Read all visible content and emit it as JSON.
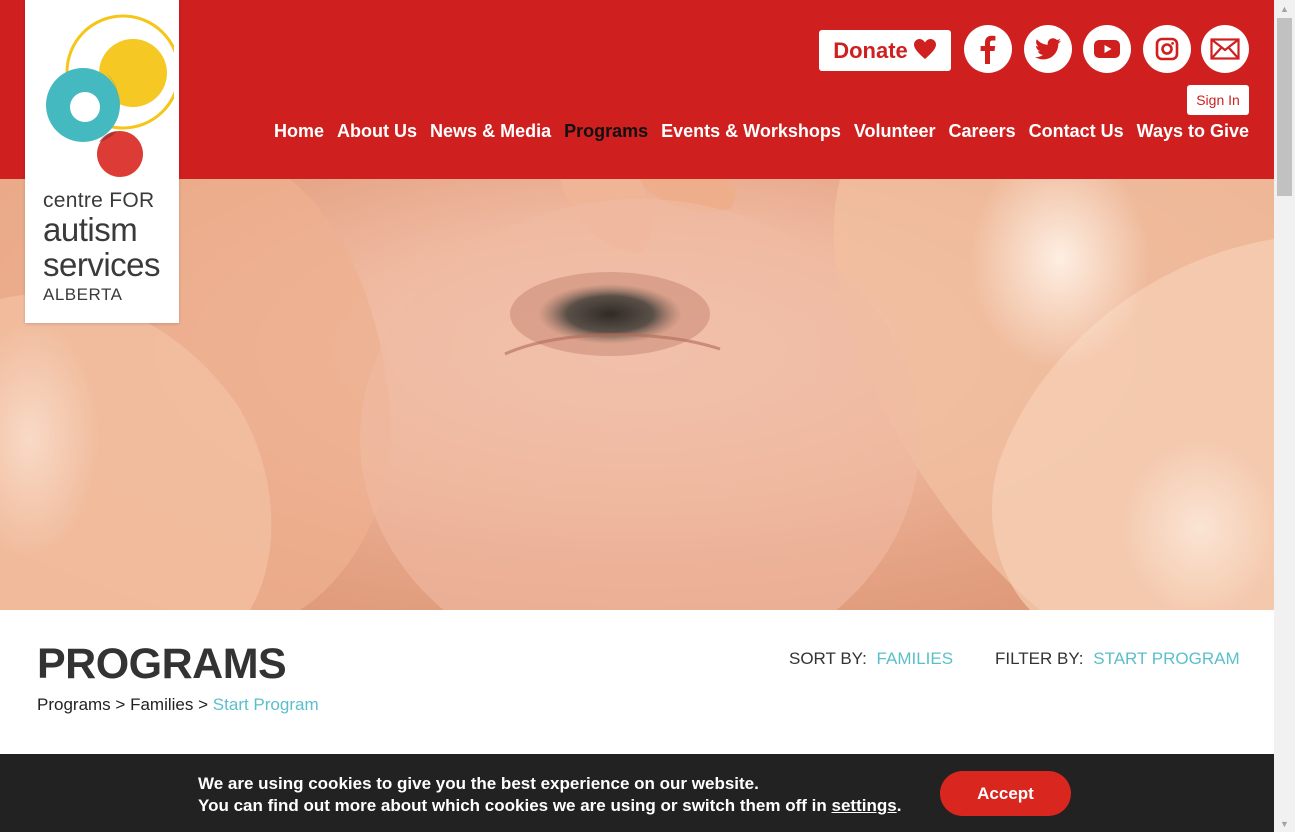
{
  "logo": {
    "line1": "centre FOR",
    "line2": "autism",
    "line3": "services",
    "line4": "ALBERTA",
    "colors": {
      "yellow": "#f5c518",
      "teal": "#45b9c0",
      "red": "#d9261f",
      "green": "#7fa13c"
    }
  },
  "header": {
    "background": "#cf1f1f",
    "donate_label": "Donate",
    "signin_label": "Sign In",
    "social": [
      "facebook-icon",
      "twitter-icon",
      "youtube-icon",
      "instagram-icon",
      "email-icon"
    ]
  },
  "nav": {
    "items": [
      {
        "label": "Home",
        "active": false
      },
      {
        "label": "About Us",
        "active": false
      },
      {
        "label": "News & Media",
        "active": false
      },
      {
        "label": "Programs",
        "active": true
      },
      {
        "label": "Events & Workshops",
        "active": false
      },
      {
        "label": "Volunteer",
        "active": false
      },
      {
        "label": "Careers",
        "active": false
      },
      {
        "label": "Contact Us",
        "active": false
      },
      {
        "label": "Ways to Give",
        "active": false
      }
    ]
  },
  "main": {
    "title": "PROGRAMS",
    "breadcrumb": {
      "crumb1": "Programs",
      "crumb2": "Families",
      "current": "Start Program",
      "separator": ">"
    },
    "sort": {
      "label": "SORT BY:",
      "value": "FAMILIES"
    },
    "filter": {
      "label": "FILTER BY:",
      "value": "START PROGRAM"
    },
    "accent": "#5bbfcb"
  },
  "cookie": {
    "line1": "We are using cookies to give you the best experience on our website.",
    "line2_prefix": "You can find out more about which cookies we are using or switch them off in",
    "link": "settings",
    "line2_suffix": ".",
    "accept_label": "Accept"
  }
}
